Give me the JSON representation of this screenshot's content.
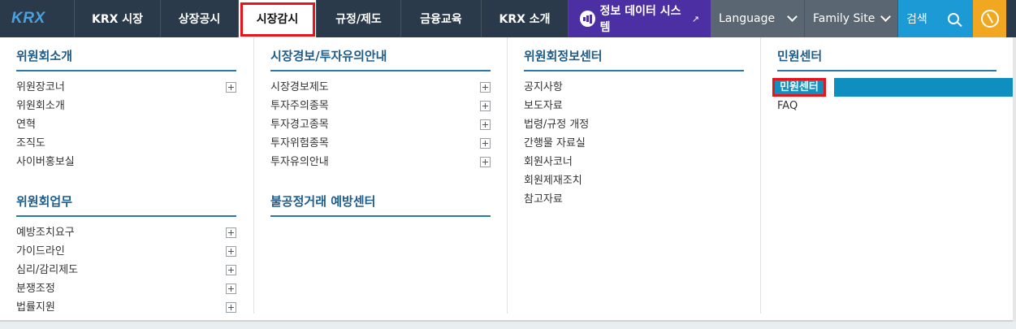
{
  "nav": {
    "logo": "KRX",
    "items": [
      {
        "label": "KRX 시장"
      },
      {
        "label": "상장공시"
      },
      {
        "label": "시장감시"
      },
      {
        "label": "규정/제도"
      },
      {
        "label": "금융교육"
      },
      {
        "label": "KRX 소개"
      }
    ],
    "info_system": "정보 데이터 시스템",
    "info_ext_icon": "external-link-icon",
    "language": "Language",
    "family_site": "Family Site",
    "search": "검색"
  },
  "menu": {
    "col1": {
      "groups": [
        {
          "title": "위원회소개",
          "items": [
            {
              "label": "위원장코너",
              "expandable": true
            },
            {
              "label": "위원회소개",
              "expandable": false
            },
            {
              "label": "연혁",
              "expandable": false
            },
            {
              "label": "조직도",
              "expandable": false
            },
            {
              "label": "사이버홍보실",
              "expandable": false
            }
          ]
        },
        {
          "title": "위원회업무",
          "items": [
            {
              "label": "예방조치요구",
              "expandable": true
            },
            {
              "label": "가이드라인",
              "expandable": true
            },
            {
              "label": "심리/감리제도",
              "expandable": true
            },
            {
              "label": "분쟁조정",
              "expandable": true
            },
            {
              "label": "법률지원",
              "expandable": true
            }
          ]
        }
      ]
    },
    "col2": {
      "groups": [
        {
          "title": "시장경보/투자유의안내",
          "items": [
            {
              "label": "시장경보제도",
              "expandable": true
            },
            {
              "label": "투자주의종목",
              "expandable": true
            },
            {
              "label": "투자경고종목",
              "expandable": true
            },
            {
              "label": "투자위험종목",
              "expandable": true
            },
            {
              "label": "투자유의안내",
              "expandable": true
            }
          ]
        },
        {
          "title": "불공정거래 예방센터",
          "items": []
        }
      ]
    },
    "col3": {
      "groups": [
        {
          "title": "위원회정보센터",
          "items": [
            {
              "label": "공지사항"
            },
            {
              "label": "보도자료"
            },
            {
              "label": "법령/규정 개정"
            },
            {
              "label": "간행물 자료실"
            },
            {
              "label": "회원사코너"
            },
            {
              "label": "회원제재조치"
            },
            {
              "label": "참고자료"
            }
          ]
        }
      ]
    },
    "col4": {
      "title": "민원센터",
      "items": [
        {
          "label": "민원센터",
          "selected": true
        },
        {
          "label": "FAQ"
        }
      ]
    }
  },
  "colors": {
    "nav_bg": "#2b3a4a",
    "info_bg": "#4b2fa3",
    "search_bg": "#1b9ad6",
    "compass_bg": "#f1a820",
    "title_blue": "#1e5c8a",
    "highlight": "#0e8fc0",
    "focus_red": "#e8141c"
  }
}
